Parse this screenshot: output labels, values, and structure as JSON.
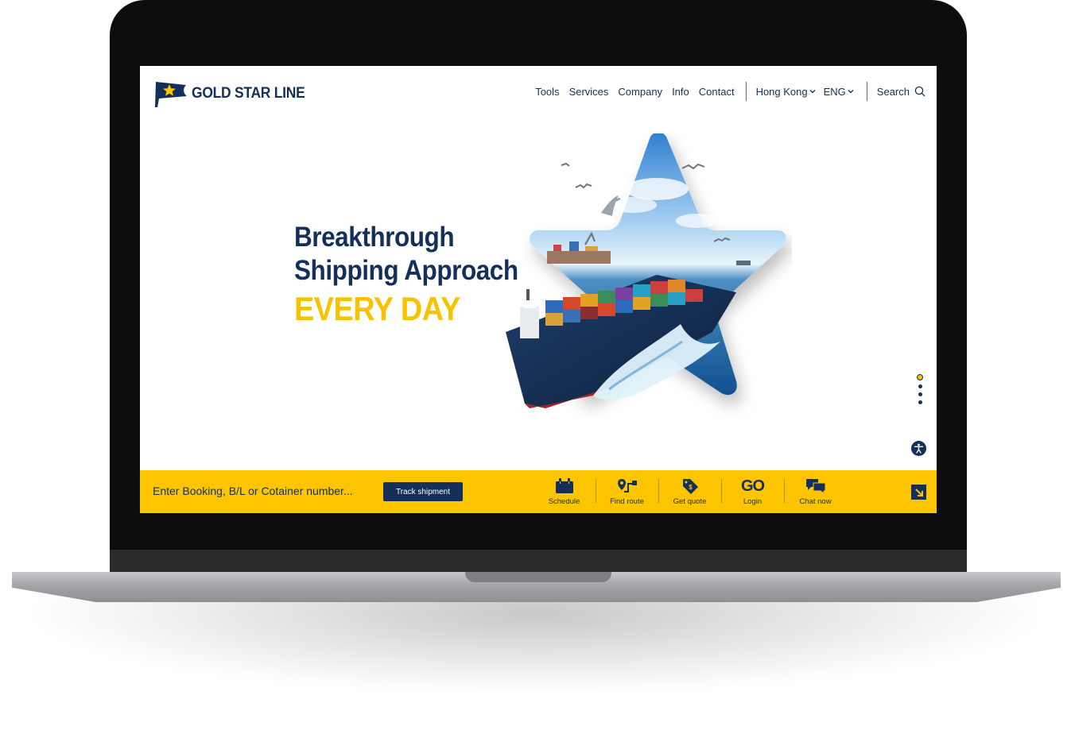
{
  "brand": {
    "name": "GOLD STAR LINE",
    "navy": "#14305a",
    "gold": "#fcc500"
  },
  "header": {
    "nav": [
      "Tools",
      "Services",
      "Company",
      "Info",
      "Contact"
    ],
    "region": "Hong Kong",
    "language": "ENG",
    "search_label": "Search"
  },
  "hero": {
    "line1": "Breakthrough",
    "line2": "Shipping Approach",
    "line3": "EVERY DAY",
    "slides_total": 4,
    "active_slide": 1
  },
  "bottom_bar": {
    "tracking_placeholder": "Enter Booking, B/L or Cotainer number...",
    "track_button": "Track shipment",
    "quick_links": [
      {
        "label": "Schedule",
        "icon": "calendar-icon"
      },
      {
        "label": "Find route",
        "icon": "route-icon"
      },
      {
        "label": "Get quote",
        "icon": "price-tag-icon"
      },
      {
        "label": "Login",
        "icon": "go-logo-icon",
        "icon_text": "GO"
      },
      {
        "label": "Chat now",
        "icon": "chat-bubbles-icon"
      }
    ]
  }
}
